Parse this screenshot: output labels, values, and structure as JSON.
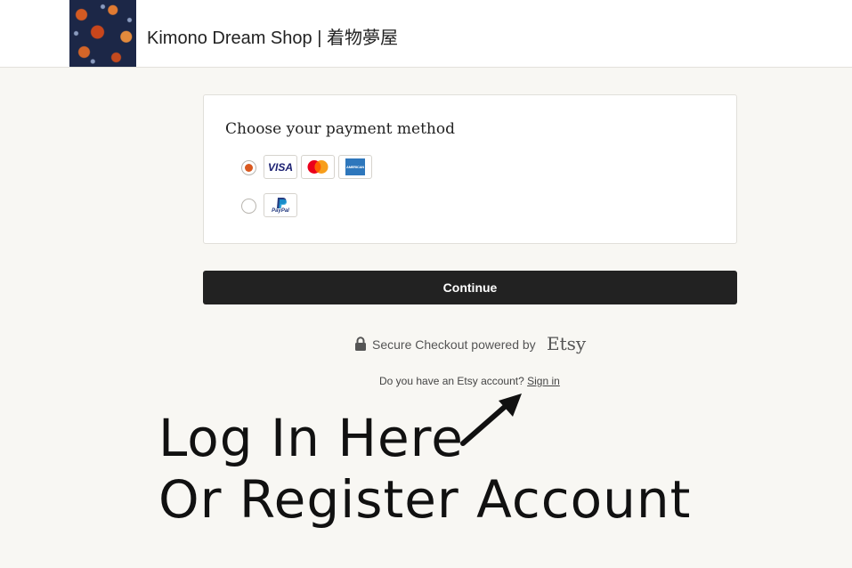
{
  "header": {
    "shop_name": "Kimono Dream Shop | 着物夢屋"
  },
  "payment": {
    "title": "Choose your payment method",
    "options": [
      {
        "selected": true,
        "brands": [
          "VISA",
          "Mastercard",
          "AMERICAN EXPRESS"
        ]
      },
      {
        "selected": false,
        "brands": [
          "PayPal"
        ]
      }
    ],
    "visa_label": "VISA",
    "amex_label": "AMERICAN EXPRESS",
    "paypal_label": "PayPal"
  },
  "continue_label": "Continue",
  "secure": {
    "text": "Secure Checkout powered by",
    "brand": "Etsy"
  },
  "account": {
    "prompt": "Do you have an Etsy account?",
    "sign_in": "Sign in"
  },
  "annotation": {
    "line1": "Log In Here",
    "line2": "Or Register Account"
  },
  "colors": {
    "accent": "#d9581f",
    "button_bg": "#222222",
    "page_bg": "#f8f7f3"
  }
}
